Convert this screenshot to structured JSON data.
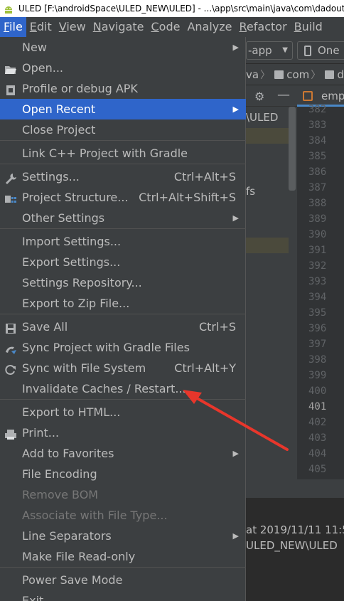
{
  "window": {
    "title": "ULED [F:\\androidSpace\\ULED_NEW\\ULED] - ...\\app\\src\\main\\java\\com\\dadoutek\\uled"
  },
  "menubar": [
    {
      "label": "File",
      "mnemonic": "F",
      "rest": "ile",
      "active": true
    },
    {
      "label": "Edit",
      "mnemonic": "E",
      "rest": "dit"
    },
    {
      "label": "View",
      "mnemonic": "V",
      "rest": "iew"
    },
    {
      "label": "Navigate",
      "mnemonic": "N",
      "rest": "avigate"
    },
    {
      "label": "Code",
      "mnemonic": "C",
      "rest": "ode"
    },
    {
      "label": "Analyze",
      "mnemonic": "",
      "rest": "Analyze"
    },
    {
      "label": "Refactor",
      "mnemonic": "R",
      "rest": "efactor"
    },
    {
      "label": "Build",
      "mnemonic": "B",
      "rest": "uild"
    }
  ],
  "toolbar": {
    "run_config": "-app",
    "device": "One"
  },
  "breadcrumb": {
    "part1": "va",
    "part2": "com",
    "part3": "d"
  },
  "panel": {
    "row1": "\\ULED",
    "row2": "fs"
  },
  "editor": {
    "tab_label": "emp",
    "line_numbers": [
      "382",
      "383",
      "384",
      "385",
      "386",
      "387",
      "388",
      "389",
      "390",
      "391",
      "392",
      "393",
      "394",
      "395",
      "396",
      "397",
      "398",
      "399",
      "400",
      "401",
      "402",
      "403",
      "404",
      "405"
    ],
    "current_line": "401"
  },
  "bottom": {
    "line1": "at 2019/11/11 11:5",
    "line2": "ULED_NEW\\ULED"
  },
  "file_menu": {
    "items": [
      {
        "label": "New",
        "submenu": true
      },
      {
        "label": "Open...",
        "icon": "folder-open-icon"
      },
      {
        "label": "Profile or debug APK",
        "icon": "apk-icon"
      },
      {
        "label": "Open Recent",
        "submenu": true,
        "selected": true
      },
      {
        "label": "Close Project"
      },
      {
        "label": "Link C++ Project with Gradle"
      },
      {
        "label": "Settings...",
        "shortcut": "Ctrl+Alt+S",
        "icon": "wrench-icon"
      },
      {
        "label": "Project Structure...",
        "shortcut": "Ctrl+Alt+Shift+S",
        "icon": "project-structure-icon"
      },
      {
        "label": "Other Settings",
        "submenu": true
      },
      {
        "label": "Import Settings..."
      },
      {
        "label": "Export Settings..."
      },
      {
        "label": "Settings Repository..."
      },
      {
        "label": "Export to Zip File..."
      },
      {
        "label": "Save All",
        "shortcut": "Ctrl+S",
        "icon": "save-icon"
      },
      {
        "label": "Sync Project with Gradle Files",
        "icon": "gradle-sync-icon"
      },
      {
        "label": "Sync with File System",
        "shortcut": "Ctrl+Alt+Y",
        "icon": "refresh-icon"
      },
      {
        "label": "Invalidate Caches / Restart..."
      },
      {
        "label": "Export to HTML..."
      },
      {
        "label": "Print...",
        "icon": "printer-icon"
      },
      {
        "label": "Add to Favorites",
        "submenu": true
      },
      {
        "label": "File Encoding"
      },
      {
        "label": "Remove BOM",
        "disabled": true
      },
      {
        "label": "Associate with File Type...",
        "disabled": true
      },
      {
        "label": "Line Separators",
        "submenu": true
      },
      {
        "label": "Make File Read-only"
      },
      {
        "label": "Power Save Mode"
      },
      {
        "label": "Exit"
      }
    ]
  },
  "colors": {
    "menu_bg": "#3c3f41",
    "selection": "#2f65ca",
    "annotation_arrow": "#e8362b"
  }
}
